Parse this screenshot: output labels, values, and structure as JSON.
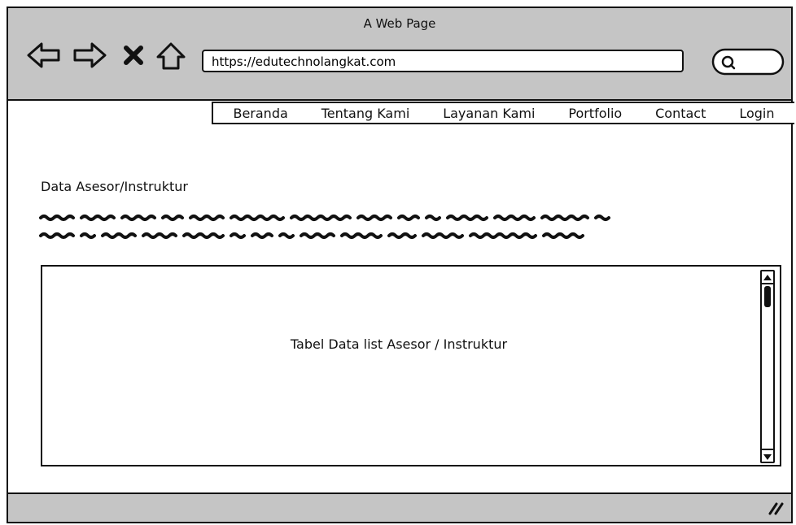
{
  "window": {
    "title": "A Web Page"
  },
  "browser": {
    "url": "https://edutechnolangkat.com",
    "back_icon": "back-arrow-icon",
    "forward_icon": "forward-arrow-icon",
    "close_icon": "close-icon",
    "home_icon": "home-icon",
    "search_icon": "search-icon"
  },
  "nav": {
    "items": [
      {
        "label": "Beranda"
      },
      {
        "label": "Tentang Kami"
      },
      {
        "label": "Layanan Kami"
      },
      {
        "label": "Portfolio"
      },
      {
        "label": "Contact"
      },
      {
        "label": "Login"
      }
    ]
  },
  "main": {
    "heading": "Data Asesor/Instruktur",
    "table_placeholder": "Tabel Data list Asesor / Instruktur"
  }
}
